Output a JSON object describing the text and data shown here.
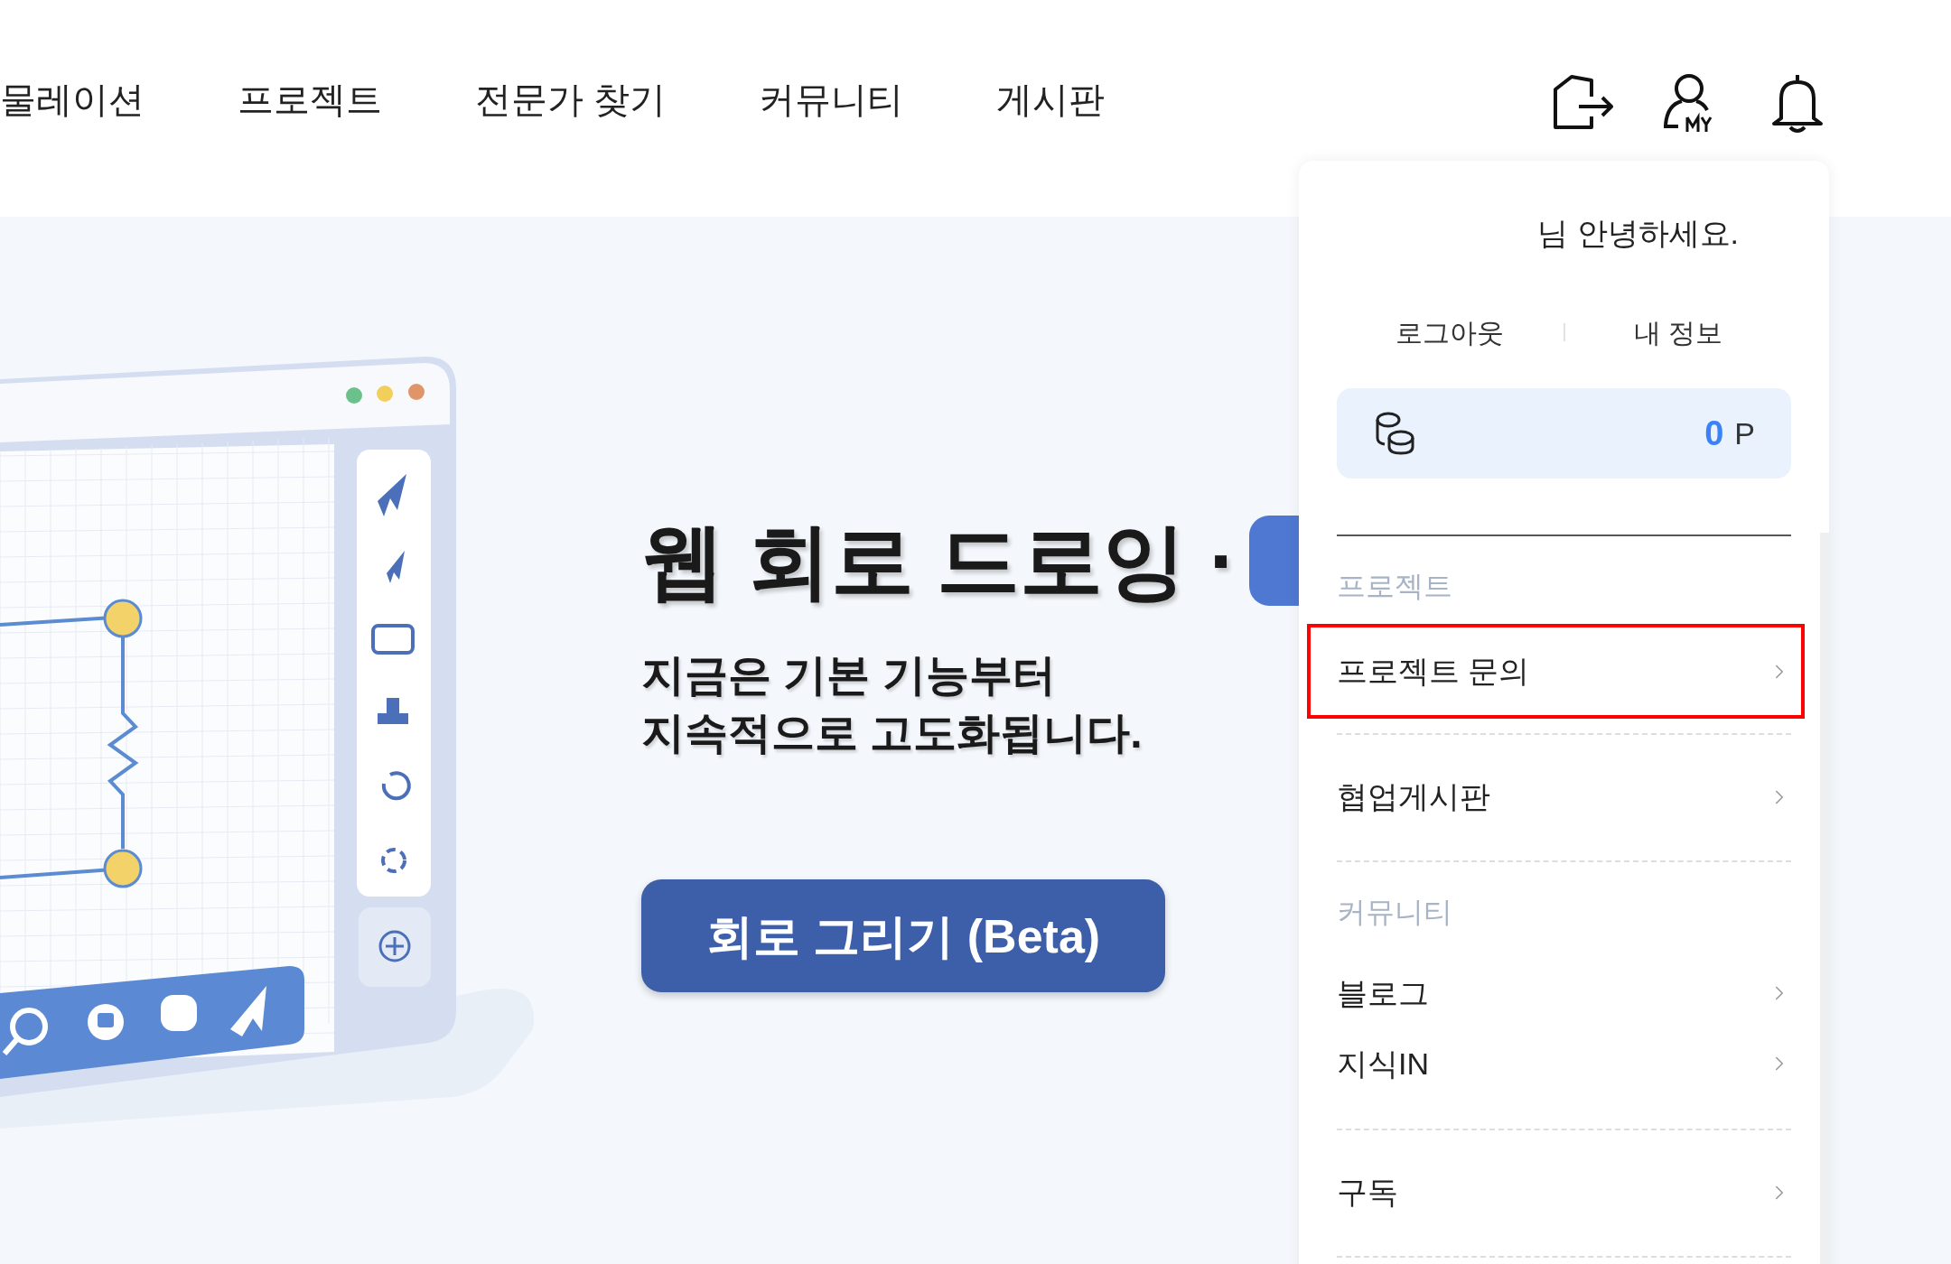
{
  "nav": {
    "items": [
      {
        "label": "물레이션"
      },
      {
        "label": "프로젝트"
      },
      {
        "label": "전문가 찾기"
      },
      {
        "label": "커뮤니티"
      },
      {
        "label": "게시판"
      }
    ]
  },
  "hero": {
    "title": "웹 회로 드로잉 ·",
    "subtitle_lines": [
      "지금은 기본 기능부터",
      "지속적으로 고도화됩니다."
    ],
    "cta": "회로 그리기 (Beta)"
  },
  "user_menu": {
    "greeting": "님 안녕하세요.",
    "links": [
      "로그아웃",
      "내 정보"
    ],
    "points": {
      "value": "0",
      "unit": "P"
    },
    "sections": [
      {
        "title": "프로젝트",
        "compact": false,
        "items": [
          {
            "label": "프로젝트 문의",
            "highlighted": true
          },
          {
            "label": "협업게시판",
            "highlighted": false
          }
        ]
      },
      {
        "title": "커뮤니티",
        "compact": true,
        "items": [
          {
            "label": "블로그",
            "highlighted": false
          },
          {
            "label": "지식IN",
            "highlighted": false
          }
        ]
      },
      {
        "compact": false,
        "items": [
          {
            "label": "구독",
            "highlighted": false
          }
        ]
      }
    ]
  }
}
